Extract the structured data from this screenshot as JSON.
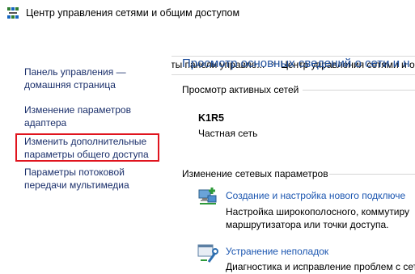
{
  "window": {
    "title": "Центр управления сетями и общим доступом"
  },
  "address": {
    "crumbs": [
      "Все элементы панели управле...",
      "Центр управления сетями и об"
    ]
  },
  "sidebar": {
    "items": [
      {
        "line1": "Панель управления —",
        "line2": "домашняя страница"
      },
      {
        "line1": "Изменение параметров",
        "line2": "адаптера"
      },
      {
        "line1": "Изменить дополнительные",
        "line2": "параметры общего доступа"
      },
      {
        "line1": "Параметры потоковой",
        "line2": "передачи мультимедиа"
      }
    ]
  },
  "main": {
    "title": "Просмотр основных сведений о сети и н",
    "active_networks_heading": "Просмотр активных сетей",
    "network": {
      "name": "K1R5",
      "type": "Частная сеть"
    },
    "change_heading": "Изменение сетевых параметров",
    "actions": [
      {
        "title": "Создание и настройка нового подключе",
        "desc1": "Настройка широкополосного, коммутиру",
        "desc2": "маршрутизатора или точки доступа."
      },
      {
        "title": "Устранение неполадок",
        "desc1": "Диагностика и исправление проблем с сет"
      }
    ]
  },
  "colors": {
    "link": "#1a55b0",
    "nav_link": "#1a2f6b",
    "title": "#1e4e9c",
    "highlight": "#e0141e"
  }
}
